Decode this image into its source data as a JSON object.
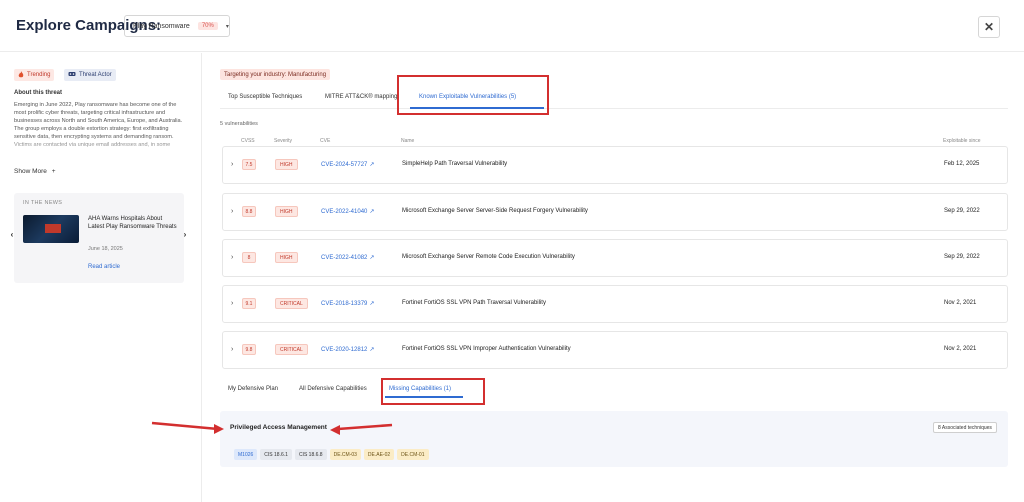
{
  "header": {
    "title": "Explore Campaigns:",
    "campaign": "Play Ransomware",
    "campaign_pct": "70%",
    "caret": "▾",
    "close": "✕"
  },
  "left": {
    "pills": {
      "trending": "Trending",
      "threat_actor": "Threat Actor"
    },
    "about_title": "About this threat",
    "about_text": "Emerging in June 2022, Play ransomware has become one of the most prolific cyber threats, targeting critical infrastructure and businesses across North and South America, Europe, and Australia. The group employs a double extortion strategy: first exfiltrating sensitive data, then encrypting systems and demanding ransom. Victims are contacted via unique email addresses and, in some",
    "show_more": "Show More",
    "news": {
      "label": "IN THE NEWS",
      "headline": "AHA Warns Hospitals About Latest Play Ransomware Threats",
      "date": "June 18, 2025",
      "read": "Read article"
    }
  },
  "main": {
    "industry": "Targeting your industry: Manufacturing",
    "tabs": [
      {
        "label": "Top Susceptible Techniques"
      },
      {
        "label": "MITRE ATT&CK® mapping"
      },
      {
        "label": "Known Exploitable Vulnerabilities (5)"
      }
    ],
    "count": "5 vulnerabilities",
    "columns": {
      "cvss": "CVSS",
      "severity": "Severity",
      "cve": "CVE",
      "name": "Name",
      "since": "Exploitable since"
    },
    "vulns": [
      {
        "cvss": "7.5",
        "severity": "HIGH",
        "cve": "CVE-2024-57727",
        "name": "SimpleHelp Path Traversal Vulnerability",
        "since": "Feb 12, 2025"
      },
      {
        "cvss": "8.8",
        "severity": "HIGH",
        "cve": "CVE-2022-41040",
        "name": "Microsoft Exchange Server Server-Side Request Forgery Vulnerability",
        "since": "Sep 29, 2022"
      },
      {
        "cvss": "8",
        "severity": "HIGH",
        "cve": "CVE-2022-41082",
        "name": "Microsoft Exchange Server Remote Code Execution Vulnerability",
        "since": "Sep 29, 2022"
      },
      {
        "cvss": "9.1",
        "severity": "CRITICAL",
        "cve": "CVE-2018-13379",
        "name": "Fortinet FortiOS SSL VPN Path Traversal Vulnerability",
        "since": "Nov 2, 2021"
      },
      {
        "cvss": "9.8",
        "severity": "CRITICAL",
        "cve": "CVE-2020-12812",
        "name": "Fortinet FortiOS SSL VPN Improper Authentication Vulnerability",
        "since": "Nov 2, 2021"
      }
    ],
    "defense_tabs": [
      {
        "label": "My Defensive Plan"
      },
      {
        "label": "All Defensive Capabilities"
      },
      {
        "label": "Missing Capabilities (1)"
      }
    ],
    "capability": {
      "title": "Privileged Access Management",
      "associated": "8 Associated techniques",
      "tags": [
        "M1026",
        "CIS 18.6.1",
        "CIS 18.6.8",
        "DE.CM-03",
        "DE.AE-02",
        "DE.CM-01"
      ]
    }
  },
  "colors": {
    "accent": "#2f6bd1",
    "annotation_red": "#d32f2f",
    "severity_bg": "#fde7e2",
    "severity_text": "#c0392b"
  }
}
